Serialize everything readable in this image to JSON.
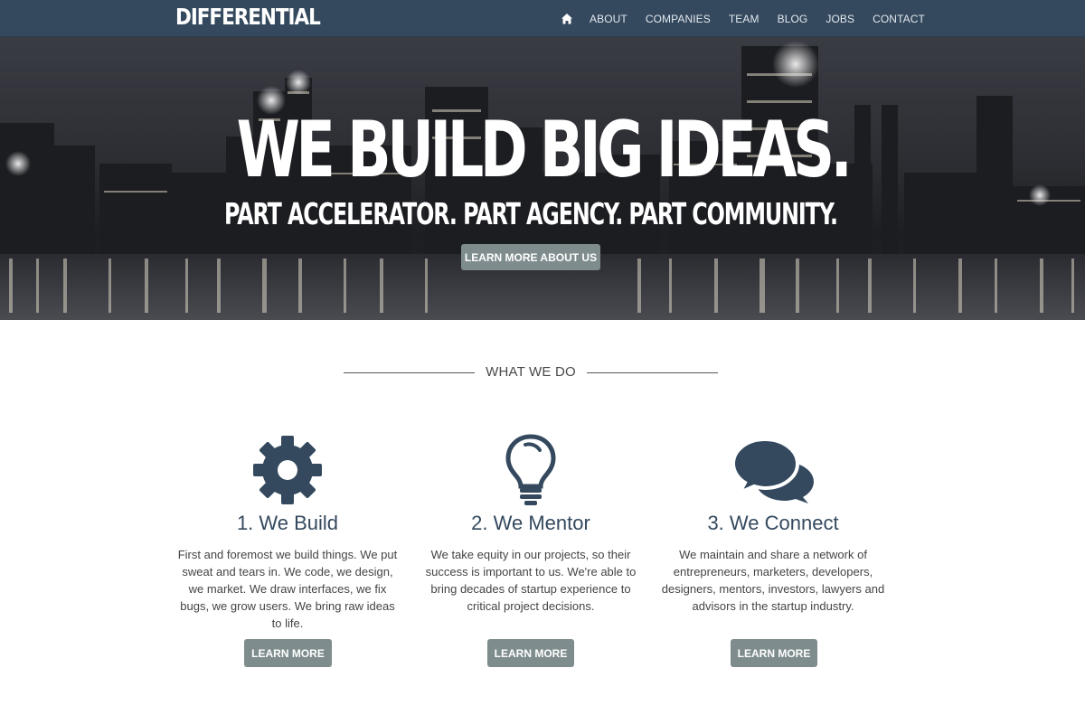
{
  "brand": "DIFFERENTIAL",
  "nav": {
    "home_icon": "home-icon",
    "items": [
      "ABOUT",
      "COMPANIES",
      "TEAM",
      "BLOG",
      "JOBS",
      "CONTACT"
    ]
  },
  "hero": {
    "title": "WE BUILD BIG IDEAS.",
    "subtitle": "PART ACCELERATOR. PART AGENCY. PART COMMUNITY.",
    "button": "LEARN MORE ABOUT US"
  },
  "section": {
    "title": "WHAT WE DO"
  },
  "cards": [
    {
      "icon": "gear-icon",
      "title": "1. We Build",
      "text": "First and foremost we build things. We put sweat and tears in. We code, we design, we market. We draw interfaces, we fix bugs, we grow users. We bring raw ideas to life.",
      "button": "LEARN MORE"
    },
    {
      "icon": "lightbulb-icon",
      "title": "2. We Mentor",
      "text": "We take equity in our projects, so their success is important to us. We're able to bring decades of startup experience to critical project decisions.",
      "button": "LEARN MORE"
    },
    {
      "icon": "chat-bubbles-icon",
      "title": "3. We Connect",
      "text": "We maintain and share a network of entrepreneurs, marketers, developers, designers, mentors, investors, lawyers and advisors in the startup industry.",
      "button": "LEARN MORE"
    }
  ],
  "colors": {
    "nav_bg": "#34495e",
    "accent": "#34495e",
    "button": "#7f8c8d"
  }
}
